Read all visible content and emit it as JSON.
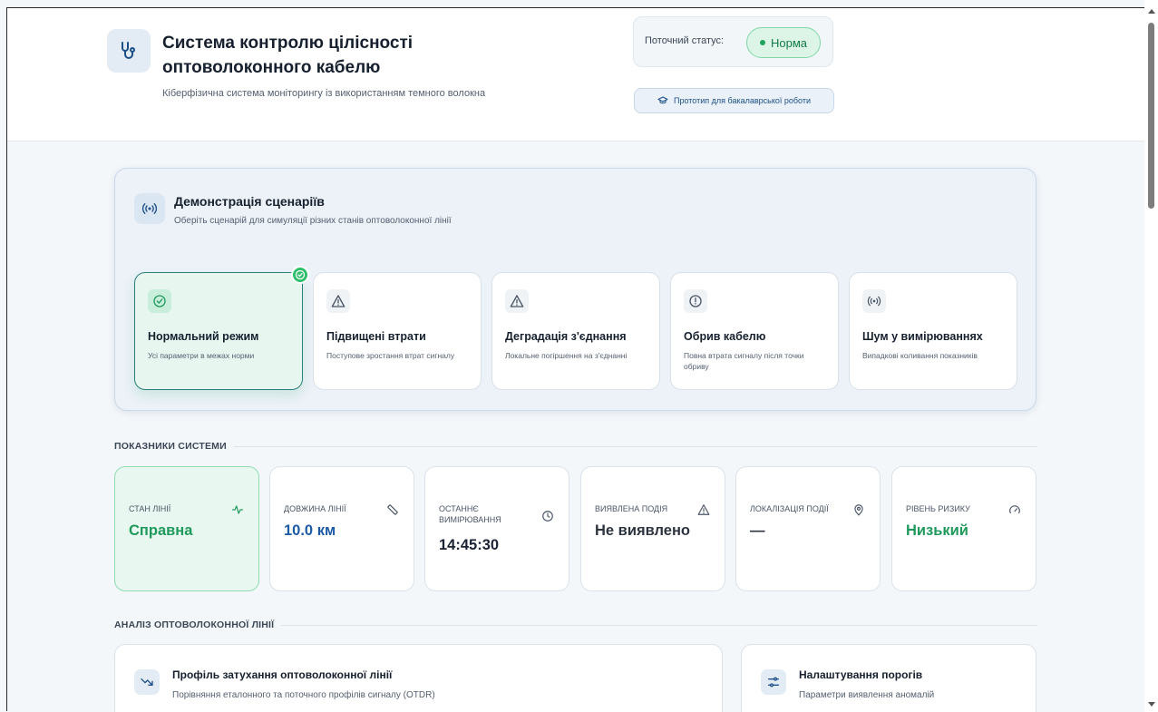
{
  "header": {
    "title": "Система контролю цілісності оптоволоконного кабелю",
    "subtitle": "Кіберфізична система моніторингу із використанням темного волокна",
    "status_label": "Поточний статус:",
    "status_value": "Норма",
    "prototype_label": "Прототип для бакалаврської роботи"
  },
  "scenarios": {
    "title": "Демонстрація сценаріїв",
    "subtitle": "Оберіть сценарій для симуляції різних станів оптоволоконної лінії",
    "items": [
      {
        "title": "Нормальний режим",
        "desc": "Усі параметри в межах норми",
        "icon": "check-circle-icon"
      },
      {
        "title": "Підвищені втрати",
        "desc": "Поступове зростання втрат сигналу",
        "icon": "warning-triangle-icon"
      },
      {
        "title": "Деградація з'єднання",
        "desc": "Локальне погіршення на з'єднанні",
        "icon": "warning-triangle-icon"
      },
      {
        "title": "Обрив кабелю",
        "desc": "Повна втрата сигналу після точки обриву",
        "icon": "alert-circle-icon"
      },
      {
        "title": "Шум у вимірюваннях",
        "desc": "Випадкові коливання показників",
        "icon": "radio-signal-icon"
      }
    ]
  },
  "metrics_section": "ПОКАЗНИКИ СИСТЕМИ",
  "metrics": [
    {
      "label": "СТАН ЛІНІЇ",
      "value": "Справна",
      "icon": "activity-icon"
    },
    {
      "label": "ДОВЖИНА ЛІНІЇ",
      "value": "10.0 км",
      "icon": "ruler-icon"
    },
    {
      "label": "ОСТАННЄ ВИМІРЮВАННЯ",
      "value": "14:45:30",
      "icon": "clock-icon"
    },
    {
      "label": "ВИЯВЛЕНА ПОДІЯ",
      "value": "Не виявлено",
      "icon": "warning-triangle-icon"
    },
    {
      "label": "ЛОКАЛІЗАЦІЯ ПОДІЇ",
      "value": "—",
      "icon": "location-pin-icon"
    },
    {
      "label": "РІВЕНЬ РИЗИКУ",
      "value": "Низький",
      "icon": "gauge-icon"
    }
  ],
  "analysis_section": "АНАЛІЗ ОПТОВОЛОКОННОЇ ЛІНІЇ",
  "analysis": {
    "profile_title": "Профіль затухання оптоволоконної лінії",
    "profile_sub": "Порівняння еталонного та поточного профілів сигналу (OTDR)",
    "thresholds_title": "Налаштування порогів",
    "thresholds_sub": "Параметри виявлення аномалій"
  },
  "colors": {
    "green": "#1f9a5c",
    "blue": "#1c5aa6",
    "dark": "#2d3440"
  }
}
